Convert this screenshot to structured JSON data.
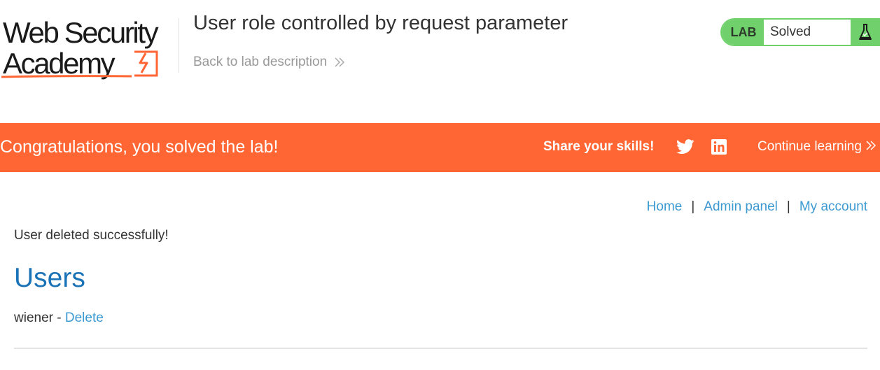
{
  "header": {
    "logo_line1": "Web Security",
    "logo_line2": "Academy",
    "lab_title": "User role controlled by request parameter",
    "back_link": "Back to lab description",
    "lab_badge": "LAB",
    "lab_status": "Solved"
  },
  "banner": {
    "message": "Congratulations, you solved the lab!",
    "share_label": "Share your skills!",
    "continue_label": "Continue learning"
  },
  "nav": {
    "home": "Home",
    "separator": "|",
    "admin_panel": "Admin panel",
    "my_account": "My account"
  },
  "main": {
    "status_message": "User deleted successfully!",
    "users_heading": "Users",
    "users": [
      {
        "name": "wiener",
        "separator": "-",
        "action": "Delete"
      }
    ]
  },
  "colors": {
    "banner": "#ff6633",
    "lab_green": "#70d16c",
    "link_blue": "#3d9ad1",
    "heading_blue": "#1a73b7"
  },
  "icons": [
    "chevron-double-right-icon",
    "flask-icon",
    "twitter-icon",
    "linkedin-icon",
    "logo-bolt-icon"
  ]
}
